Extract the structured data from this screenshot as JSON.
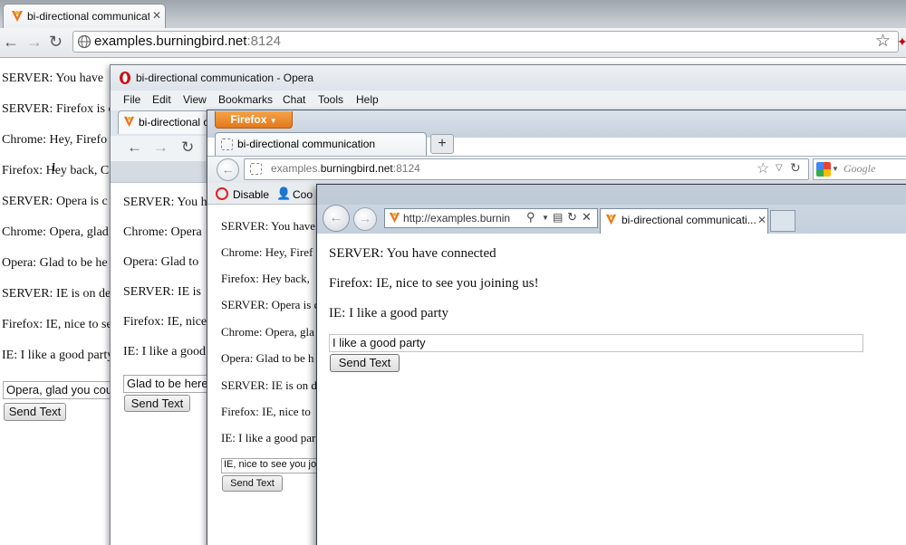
{
  "chrome": {
    "tab_title": "bi-directional communicati",
    "url_host": "examples.burningbird.net",
    "url_port": ":8124",
    "messages": [
      "SERVER: You have",
      "SERVER: Firefox is c",
      "Chrome: Hey, Firefo",
      "Firefox: Hey back, C",
      "SERVER: Opera is c",
      "Chrome: Opera, glad",
      "Opera: Glad to be he",
      "SERVER: IE is on de",
      "Firefox: IE, nice to se",
      "IE: I like a good party"
    ],
    "input_value": "Opera, glad you coul",
    "send_label": "Send Text"
  },
  "opera": {
    "window_title": "bi-directional communication - Opera",
    "menu": [
      "File",
      "Edit",
      "View",
      "Bookmarks",
      "Chat",
      "Tools",
      "Help"
    ],
    "tab_title": "bi-directional c",
    "messages": [
      "SERVER: You h",
      "Chrome: Opera",
      "Opera: Glad to",
      "SERVER: IE is",
      "Firefox: IE, nice",
      "IE: I like a good"
    ],
    "input_value": "Glad to be here,",
    "send_label": "Send Text"
  },
  "firefox": {
    "app_button": "Firefox",
    "tab_title": "bi-directional communication",
    "new_tab": "+",
    "url_prefix": "examples.",
    "url_host": "burningbird.net",
    "url_port": ":8124",
    "search_placeholder": "Google",
    "devbar_disable": "Disable",
    "devbar_cookies": "Coo",
    "messages": [
      "SERVER: You have",
      "Chrome: Hey, Firef",
      "Firefox: Hey back,",
      "SERVER: Opera is c",
      "Chrome: Opera, gla",
      "Opera: Glad to be h",
      "SERVER: IE is on d",
      "Firefox: IE, nice to",
      "IE: I like a good par"
    ],
    "input_value": "IE, nice to see you join",
    "send_label": "Send Text"
  },
  "ie": {
    "url": "http://examples.burnin",
    "tab_title": "bi-directional communicati...",
    "messages": [
      "SERVER: You have connected",
      "Firefox: IE, nice to see you joining us!",
      "IE: I like a good party"
    ],
    "input_value": "I like a good party",
    "send_label": "Send Text"
  },
  "colors": {
    "firefox_orange": "#e3791b",
    "opera_red": "#cc0f16",
    "chrome_blue": "#3f6fb6"
  }
}
